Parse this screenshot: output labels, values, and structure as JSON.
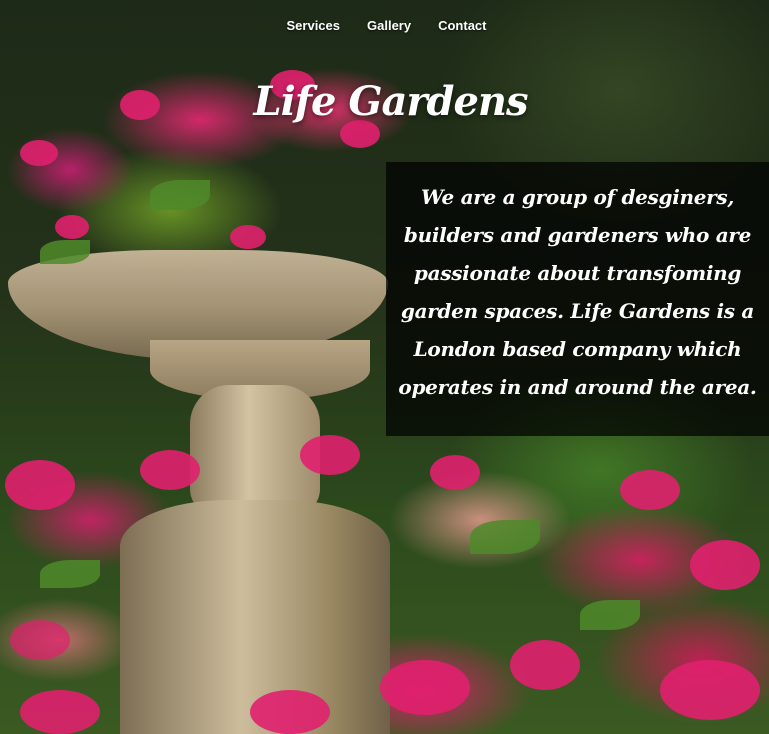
{
  "nav": {
    "items": [
      {
        "label": "Services"
      },
      {
        "label": "Gallery"
      },
      {
        "label": "Contact"
      }
    ]
  },
  "hero": {
    "title": "Life Gardens"
  },
  "about": {
    "text": "We are a group of desginers, builders and gardeners who are passionate about transfoming garden spaces. Life Gardens is a London based company which operates in and around the area."
  },
  "colors": {
    "overlay": "#000000",
    "text": "#ffffff",
    "flower_accent": "#e0206e"
  },
  "background": {
    "icon": "garden-fountain-photo"
  }
}
